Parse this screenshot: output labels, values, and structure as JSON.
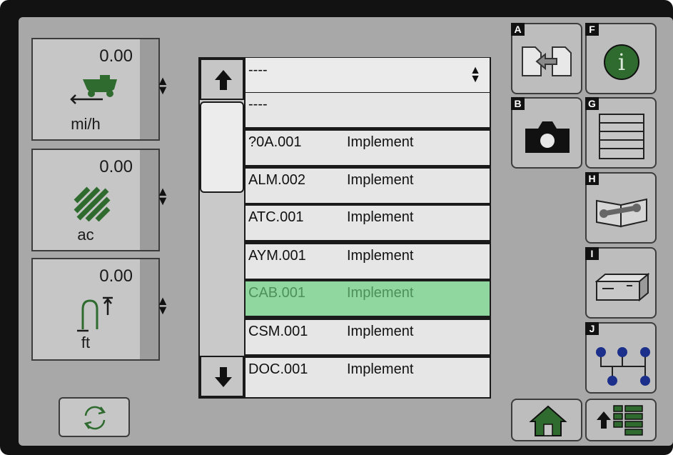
{
  "readouts": [
    {
      "value": "0.00",
      "unit": "mi/h",
      "icon": "speed-harvester-icon"
    },
    {
      "value": "0.00",
      "unit": "ac",
      "icon": "area-hatch-icon"
    },
    {
      "value": "0.00",
      "unit": "ft",
      "icon": "headland-height-icon"
    }
  ],
  "updown_glyph": "◆",
  "list": {
    "selected_display": "----",
    "items": [
      {
        "code": "----",
        "name": ""
      },
      {
        "code": "?0A.001",
        "name": "Implement"
      },
      {
        "code": "ALM.002",
        "name": "Implement"
      },
      {
        "code": "ATC.001",
        "name": "Implement"
      },
      {
        "code": "AYM.001",
        "name": "Implement"
      },
      {
        "code": "CAB.001",
        "name": "Implement",
        "selected": true
      },
      {
        "code": "CSM.001",
        "name": "Implement"
      },
      {
        "code": "DOC.001",
        "name": "Implement"
      }
    ]
  },
  "panel": {
    "A": {
      "label": "A",
      "icon": "transfer-icon"
    },
    "B": {
      "label": "B",
      "icon": "camera-icon"
    },
    "F": {
      "label": "F",
      "icon": "info-icon",
      "glyph": "i"
    },
    "G": {
      "label": "G",
      "icon": "list-lines-icon"
    },
    "H": {
      "label": "H",
      "icon": "manual-wrench-icon"
    },
    "I": {
      "label": "I",
      "icon": "ecu-box-icon"
    },
    "J": {
      "label": "J",
      "icon": "network-tree-icon"
    }
  },
  "colors": {
    "accent_green": "#2f6b2f",
    "selected_row": "#8fd79f",
    "node_blue": "#1c2f8a"
  }
}
